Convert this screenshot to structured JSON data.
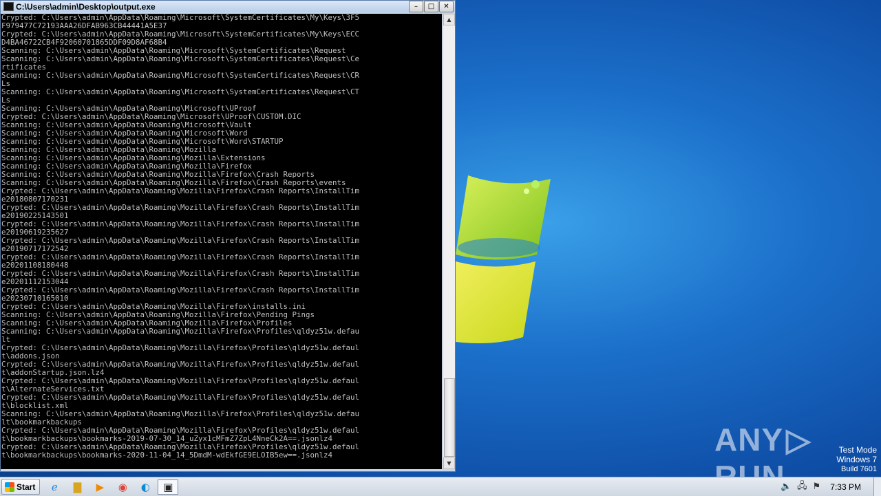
{
  "window": {
    "title": "C:\\Users\\admin\\Desktop\\output.exe",
    "lines": [
      "Crypted: C:\\Users\\admin\\AppData\\Roaming\\Microsoft\\SystemCertificates\\My\\Keys\\3F5",
      "F979477C72193AAA26DFAB963CB44441A5E37",
      "Crypted: C:\\Users\\admin\\AppData\\Roaming\\Microsoft\\SystemCertificates\\My\\Keys\\ECC",
      "D4BA46722CB4F92060701865DDF09D8AF68B4",
      "Scanning: C:\\Users\\admin\\AppData\\Roaming\\Microsoft\\SystemCertificates\\Request",
      "Scanning: C:\\Users\\admin\\AppData\\Roaming\\Microsoft\\SystemCertificates\\Request\\Ce",
      "rtificates",
      "Scanning: C:\\Users\\admin\\AppData\\Roaming\\Microsoft\\SystemCertificates\\Request\\CR",
      "Ls",
      "Scanning: C:\\Users\\admin\\AppData\\Roaming\\Microsoft\\SystemCertificates\\Request\\CT",
      "Ls",
      "Scanning: C:\\Users\\admin\\AppData\\Roaming\\Microsoft\\UProof",
      "Crypted: C:\\Users\\admin\\AppData\\Roaming\\Microsoft\\UProof\\CUSTOM.DIC",
      "Scanning: C:\\Users\\admin\\AppData\\Roaming\\Microsoft\\Vault",
      "Scanning: C:\\Users\\admin\\AppData\\Roaming\\Microsoft\\Word",
      "Scanning: C:\\Users\\admin\\AppData\\Roaming\\Microsoft\\Word\\STARTUP",
      "Scanning: C:\\Users\\admin\\AppData\\Roaming\\Mozilla",
      "Scanning: C:\\Users\\admin\\AppData\\Roaming\\Mozilla\\Extensions",
      "Scanning: C:\\Users\\admin\\AppData\\Roaming\\Mozilla\\Firefox",
      "Scanning: C:\\Users\\admin\\AppData\\Roaming\\Mozilla\\Firefox\\Crash Reports",
      "Scanning: C:\\Users\\admin\\AppData\\Roaming\\Mozilla\\Firefox\\Crash Reports\\events",
      "Crypted: C:\\Users\\admin\\AppData\\Roaming\\Mozilla\\Firefox\\Crash Reports\\InstallTim",
      "e20180807170231",
      "Crypted: C:\\Users\\admin\\AppData\\Roaming\\Mozilla\\Firefox\\Crash Reports\\InstallTim",
      "e20190225143501",
      "Crypted: C:\\Users\\admin\\AppData\\Roaming\\Mozilla\\Firefox\\Crash Reports\\InstallTim",
      "e20190619235627",
      "Crypted: C:\\Users\\admin\\AppData\\Roaming\\Mozilla\\Firefox\\Crash Reports\\InstallTim",
      "e20190717172542",
      "Crypted: C:\\Users\\admin\\AppData\\Roaming\\Mozilla\\Firefox\\Crash Reports\\InstallTim",
      "e20201108180448",
      "Crypted: C:\\Users\\admin\\AppData\\Roaming\\Mozilla\\Firefox\\Crash Reports\\InstallTim",
      "e20201112153044",
      "Crypted: C:\\Users\\admin\\AppData\\Roaming\\Mozilla\\Firefox\\Crash Reports\\InstallTim",
      "e20230710165010",
      "Crypted: C:\\Users\\admin\\AppData\\Roaming\\Mozilla\\Firefox\\installs.ini",
      "Scanning: C:\\Users\\admin\\AppData\\Roaming\\Mozilla\\Firefox\\Pending Pings",
      "Scanning: C:\\Users\\admin\\AppData\\Roaming\\Mozilla\\Firefox\\Profiles",
      "Scanning: C:\\Users\\admin\\AppData\\Roaming\\Mozilla\\Firefox\\Profiles\\qldyz51w.defau",
      "lt",
      "Crypted: C:\\Users\\admin\\AppData\\Roaming\\Mozilla\\Firefox\\Profiles\\qldyz51w.defaul",
      "t\\addons.json",
      "Crypted: C:\\Users\\admin\\AppData\\Roaming\\Mozilla\\Firefox\\Profiles\\qldyz51w.defaul",
      "t\\addonStartup.json.lz4",
      "Crypted: C:\\Users\\admin\\AppData\\Roaming\\Mozilla\\Firefox\\Profiles\\qldyz51w.defaul",
      "t\\AlternateServices.txt",
      "Crypted: C:\\Users\\admin\\AppData\\Roaming\\Mozilla\\Firefox\\Profiles\\qldyz51w.defaul",
      "t\\blocklist.xml",
      "Scanning: C:\\Users\\admin\\AppData\\Roaming\\Mozilla\\Firefox\\Profiles\\qldyz51w.defau",
      "lt\\bookmarkbackups",
      "Crypted: C:\\Users\\admin\\AppData\\Roaming\\Mozilla\\Firefox\\Profiles\\qldyz51w.defaul",
      "t\\bookmarkbackups\\bookmarks-2019-07-30_14_uZyx1cMFmZ7ZpL4NneCk2A==.jsonlz4",
      "Crypted: C:\\Users\\admin\\AppData\\Roaming\\Mozilla\\Firefox\\Profiles\\qldyz51w.defaul",
      "t\\bookmarkbackups\\bookmarks-2020-11-04_14_5DmdM-wdEkfGE9ELOIB5ew==.jsonlz4"
    ],
    "buttons": {
      "minimize": "–",
      "maximize": "□",
      "close": "✕"
    }
  },
  "desktop": {
    "watermark_left": "ANY",
    "watermark_right": "RUN",
    "test_mode_line1": "Test Mode",
    "test_mode_line2": "Windows 7",
    "test_mode_line3": "Build 7601"
  },
  "taskbar": {
    "start_label": "Start",
    "clock": "7:33 PM",
    "pinned_icons": [
      "ie-icon",
      "explorer-icon",
      "media-player-icon",
      "chrome-icon",
      "edge-icon",
      "console-icon"
    ]
  },
  "colors": {
    "console_bg": "#000000",
    "console_text": "#c0c0c0",
    "desktop_blue": "#1b6fc9"
  }
}
